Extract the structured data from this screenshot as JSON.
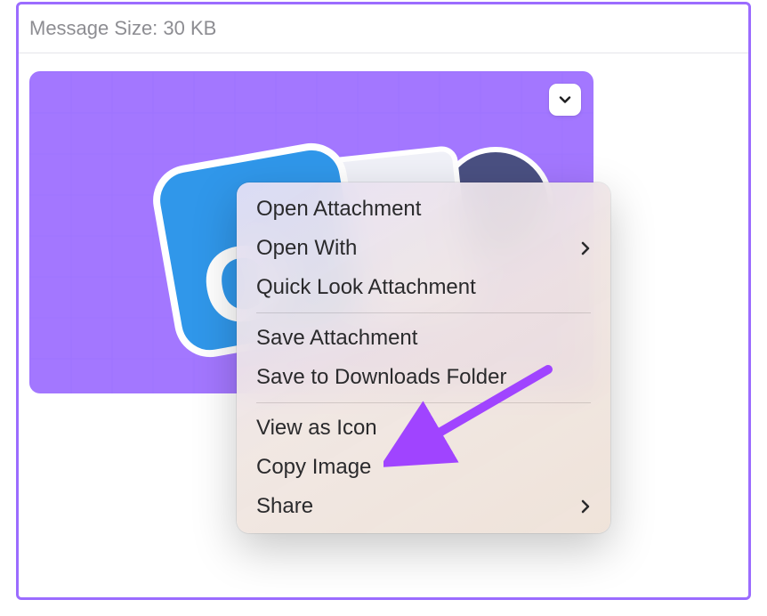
{
  "header": {
    "message_size_label": "Message Size: 30 KB"
  },
  "attachment": {
    "chevron_button_title": "Attachment actions",
    "outlook_letter": "O"
  },
  "menu": {
    "items": [
      {
        "label": "Open Attachment",
        "submenu": false
      },
      {
        "label": "Open With",
        "submenu": true
      },
      {
        "label": "Quick Look Attachment",
        "submenu": false
      },
      {
        "label": "Save Attachment",
        "submenu": false
      },
      {
        "label": "Save to Downloads Folder",
        "submenu": false
      },
      {
        "label": "View as Icon",
        "submenu": false
      },
      {
        "label": "Copy Image",
        "submenu": false
      },
      {
        "label": "Share",
        "submenu": true
      }
    ]
  },
  "annotation": {
    "arrow_target": "View as Icon",
    "arrow_color": "#a044ff"
  }
}
